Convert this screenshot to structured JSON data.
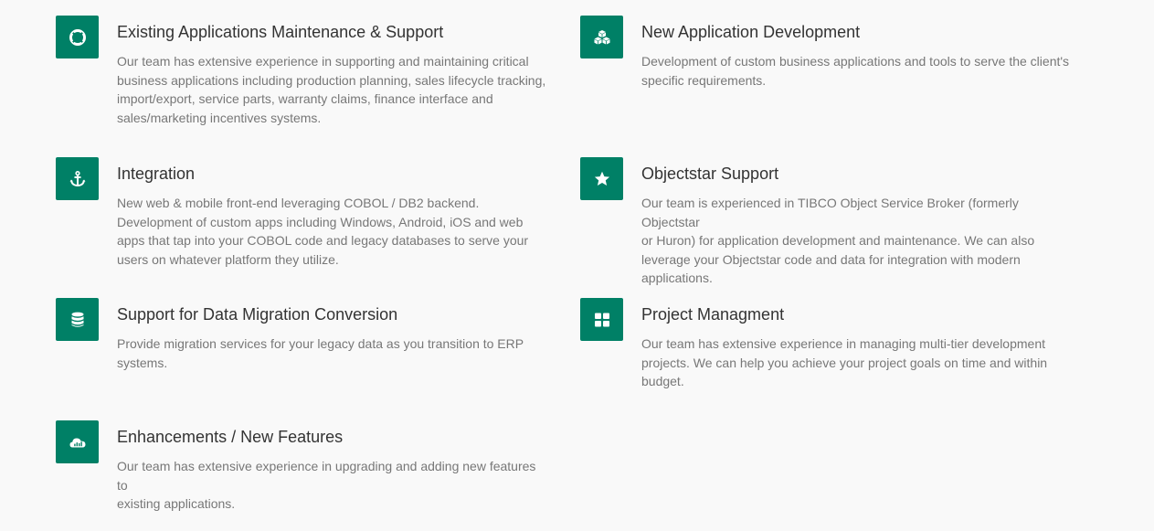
{
  "services": [
    {
      "title": "Existing Applications Maintenance & Support",
      "description_lines": [
        "Our team has extensive experience in supporting and maintaining critical",
        "business applications including production planning, sales lifecycle tracking,",
        "import/export, service parts, warranty claims, finance interface and",
        "sales/marketing incentives systems."
      ],
      "icon": "life-ring-icon"
    },
    {
      "title": "New Application Development",
      "description_lines": [
        "Development of custom business applications and tools to serve the client's",
        "specific requirements."
      ],
      "icon": "cubes-icon"
    },
    {
      "title": "Integration",
      "description_lines": [
        "New web & mobile front-end leveraging COBOL / DB2 backend.",
        "Development of custom apps including Windows, Android, iOS and web",
        "apps that tap into your COBOL code and legacy databases to serve your",
        "users on whatever platform they utilize."
      ],
      "icon": "anchor-icon"
    },
    {
      "title": "Objectstar Support",
      "description_lines": [
        "Our team is experienced in TIBCO Object Service Broker (formerly Objectstar",
        "or Huron) for application development and maintenance. We can also",
        "leverage your Objectstar code and data for integration with modern",
        "applications."
      ],
      "icon": "star-icon"
    },
    {
      "title": "Support for Data Migration Conversion",
      "description_lines": [
        "Provide migration services for your legacy data as you transition to ERP",
        "systems."
      ],
      "icon": "database-icon"
    },
    {
      "title": "Project Managment",
      "description_lines": [
        "Our team has extensive experience in managing multi-tier development",
        "projects. We can help you achieve your project goals on time and within",
        "budget."
      ],
      "icon": "grid-icon"
    },
    {
      "title": "Enhancements / New Features",
      "description_lines": [
        "Our team has extensive experience in upgrading and adding new features to",
        "existing applications."
      ],
      "icon": "cloud-chart-icon"
    }
  ],
  "colors": {
    "accent": "#008066",
    "title": "#333333",
    "text": "#777777",
    "background": "#f9f9f9"
  }
}
